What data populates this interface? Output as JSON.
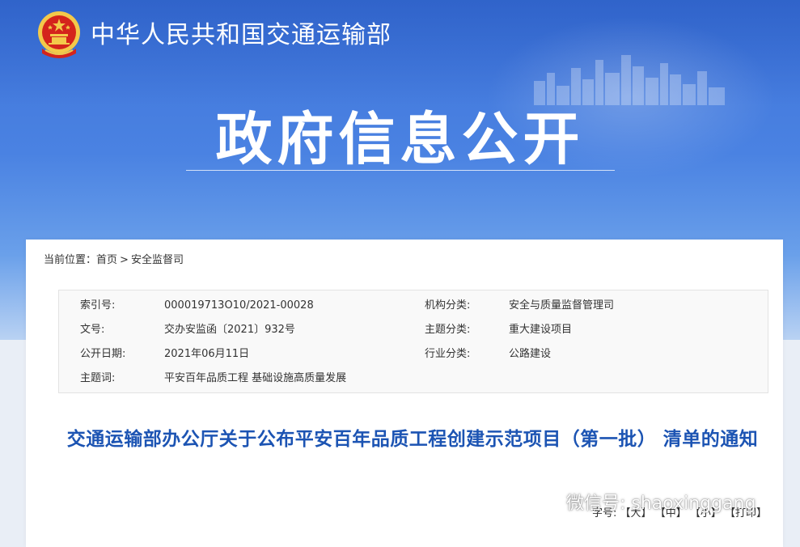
{
  "header": {
    "ministry_name": "中华人民共和国交通运输部",
    "page_title": "政府信息公开"
  },
  "breadcrumb": {
    "prefix": "当前位置：",
    "home": "首页",
    "separator": ">",
    "current": "安全监督司"
  },
  "meta": {
    "index_label": "索引号:",
    "index_value": "000019713O10/2021-00028",
    "org_label": "机构分类:",
    "org_value": "安全与质量监督管理司",
    "docno_label": "文号:",
    "docno_value": "交办安监函〔2021〕932号",
    "topic_class_label": "主题分类:",
    "topic_class_value": "重大建设项目",
    "date_label": "公开日期:",
    "date_value": "2021年06月11日",
    "industry_label": "行业分类:",
    "industry_value": "公路建设",
    "keywords_label": "主题词:",
    "keywords_value": "平安百年品质工程 基础设施高质量发展"
  },
  "document": {
    "title": "交通运输部办公厅关于公布平安百年品质工程创建示范项目（第一批） 清单的通知"
  },
  "font_size": {
    "label": "字号:",
    "large": "【大】",
    "medium": "【中】",
    "small": "【小】",
    "print": "【打印】"
  },
  "watermark": {
    "text": "微信号: shaoxinggang"
  },
  "colors": {
    "header_blue": "#3f74d9",
    "title_blue": "#1c54b3",
    "emblem_red": "#d4241c",
    "emblem_gold": "#f3c94a"
  }
}
